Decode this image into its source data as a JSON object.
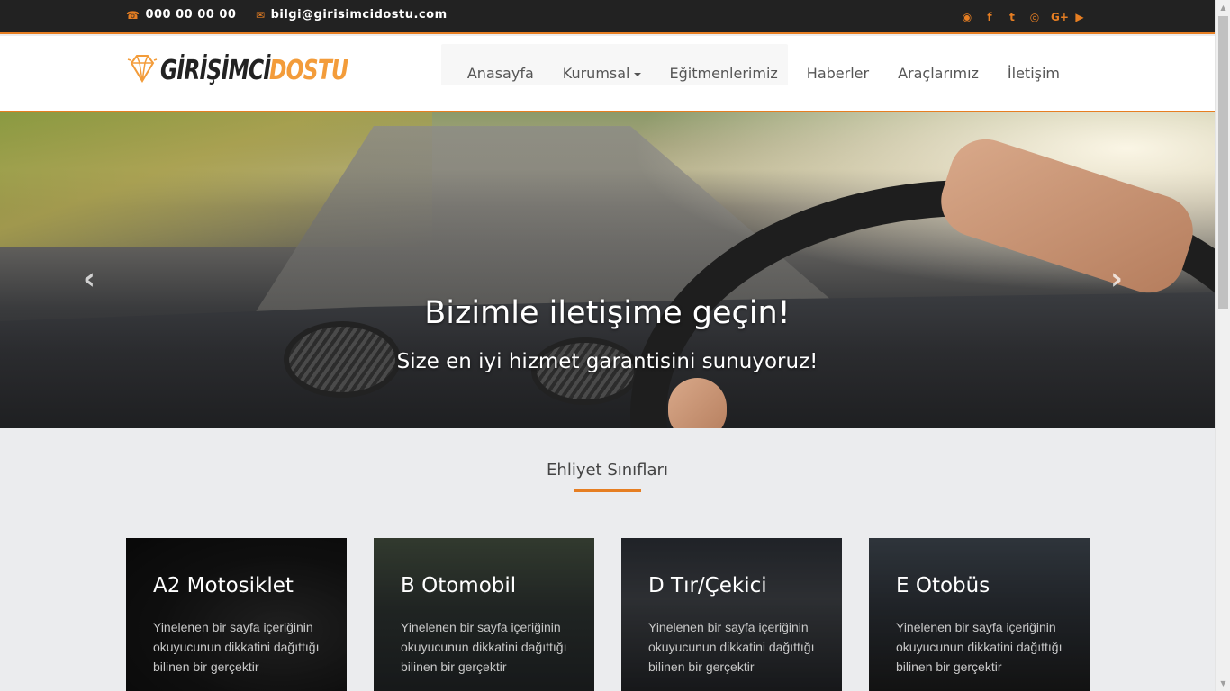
{
  "topbar": {
    "phone": "000 00 00 00",
    "email": "bilgi@girisimcidostu.com",
    "social": [
      {
        "icon": "rss-icon",
        "glyph": "◉"
      },
      {
        "icon": "facebook-icon",
        "glyph": "f"
      },
      {
        "icon": "twitter-icon",
        "glyph": "t"
      },
      {
        "icon": "instagram-icon",
        "glyph": "◎"
      },
      {
        "icon": "google-plus-icon",
        "glyph": "G+"
      },
      {
        "icon": "youtube-icon",
        "glyph": "▶"
      }
    ]
  },
  "logo": {
    "part1": "GİRİŞİMCİ",
    "part2": "DOSTU"
  },
  "nav": {
    "home": "Anasayfa",
    "corporate": "Kurumsal",
    "instructors": "Eğitmenlerimiz",
    "news": "Haberler",
    "vehicles": "Araçlarımız",
    "contact": "İletişim"
  },
  "hero": {
    "title": "Bizimle iletişime geçin!",
    "subtitle": "Size en iyi hizmet garantisini sunuyoruz!",
    "prev": "‹",
    "next": "›"
  },
  "section": {
    "title": "Ehliyet Sınıfları"
  },
  "cards": [
    {
      "title": "A2 Motosiklet",
      "text": "Yinelenen bir sayfa içeriğinin okuyucunun dikkatini dağıttığı bilinen bir gerçektir"
    },
    {
      "title": "B Otomobil",
      "text": "Yinelenen bir sayfa içeriğinin okuyucunun dikkatini dağıttığı bilinen bir gerçektir"
    },
    {
      "title": "D Tır/Çekici",
      "text": "Yinelenen bir sayfa içeriğinin okuyucunun dikkatini dağıttığı bilinen bir gerçektir"
    },
    {
      "title": "E Otobüs",
      "text": "Yinelenen bir sayfa içeriğinin okuyucunun dikkatini dağıttığı bilinen bir gerçektir"
    }
  ],
  "colors": {
    "accent": "#e67e22",
    "topbar": "#222222",
    "logo_orange": "#f39c3a"
  }
}
